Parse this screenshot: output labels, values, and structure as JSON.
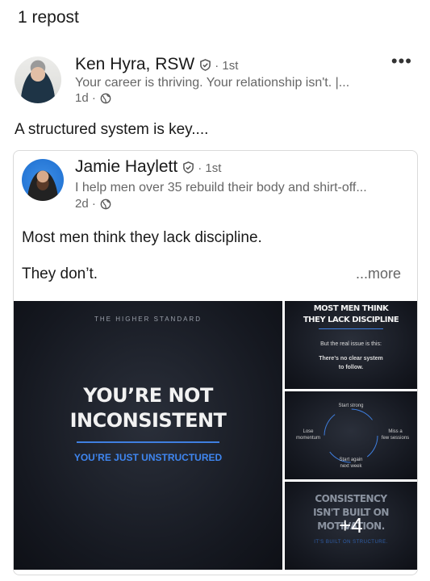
{
  "header": {
    "repost_count": "1 repost"
  },
  "reposter": {
    "name": "Ken Hyra, RSW",
    "degree": "· 1st",
    "headline": "Your career is thriving. Your relationship isn't. |...",
    "time": "1d ·",
    "more_label": "•••",
    "comment": "A structured system is key...."
  },
  "original_post": {
    "author": {
      "name": "Jamie Haylett",
      "degree": "· 1st",
      "headline": "I help men over 35 rebuild their body and shirt-off...",
      "time": "2d ·"
    },
    "text_line1": "Most men think they lack discipline.",
    "text_line2": "They don’t.",
    "see_more": "...more",
    "images": {
      "main": {
        "kicker": "THE HIGHER STANDARD",
        "title_line1": "YOU’RE NOT",
        "title_line2": "INCONSISTENT",
        "subtitle": "YOU’RE JUST UNSTRUCTURED"
      },
      "slide2": {
        "title_line1": "MOST MEN THINK",
        "title_line2": "THEY LACK DISCIPLINE",
        "line1": "But the real issue is this:",
        "line2": "There’s no clear system",
        "line3": "to follow."
      },
      "slide3": {
        "top": "Start strong",
        "right_line1": "Miss a",
        "right_line2": "few sessions",
        "bottom_line1": "Start again",
        "bottom_line2": "next week",
        "left_line1": "Lose",
        "left_line2": "momentum"
      },
      "slide4": {
        "title_line1": "CONSISTENCY",
        "title_line2": "ISN'T BUILT ON",
        "title_line3": "MOTIVATION.",
        "caption": "IT'S BUILT ON STRUCTURE.",
        "more_count": "+4"
      }
    }
  },
  "colors": {
    "accent_blue": "#3f86f0",
    "tile_dark": "#151820",
    "meta_gray": "#666666"
  }
}
